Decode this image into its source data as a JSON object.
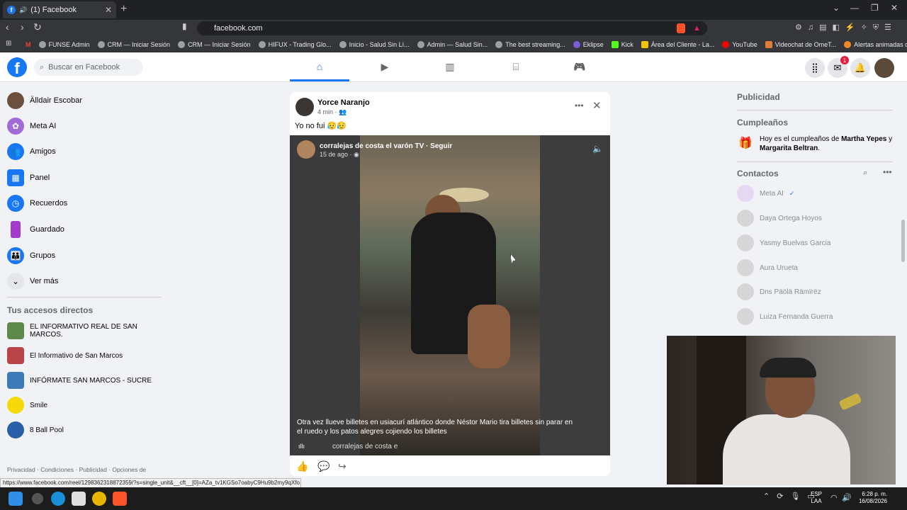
{
  "browser": {
    "tab_title": "(1) Facebook",
    "url": "facebook.com",
    "bookmarks": [
      "FUNSE Admin",
      "CRM — Iniciar Sesión",
      "CRM — Iniciar Sesión",
      "HIFUX - Trading Glo...",
      "Inicio - Salud Sin Lí...",
      "Admin — Salud Sin...",
      "The best streaming...",
      "Eklipse",
      "Kick",
      "Área del Cliente - La...",
      "YouTube",
      "Videochat de OmeT...",
      "Alertas animadas de..."
    ],
    "status_link": "https://www.facebook.com/reel/1298362318872359/?s=single_unit&__cft__[0]=AZa_tv1KGSo7oabyC9Hu9b2my9qXfo..."
  },
  "header": {
    "search_placeholder": "Buscar en Facebook",
    "messenger_badge": "1"
  },
  "sidebar": {
    "items": [
      {
        "label": "Älldair Escobar",
        "icon": "avatar",
        "color": "#6b5040"
      },
      {
        "label": "Meta AI",
        "icon": "meta-ai-icon",
        "color": "#a06cd5"
      },
      {
        "label": "Amigos",
        "icon": "friends-icon",
        "color": "#1877f2"
      },
      {
        "label": "Panel",
        "icon": "dashboard-icon",
        "color": "#1877f2"
      },
      {
        "label": "Recuerdos",
        "icon": "clock-icon",
        "color": "#1877f2"
      },
      {
        "label": "Guardado",
        "icon": "bookmark-icon",
        "color": "#a33ac9"
      },
      {
        "label": "Grupos",
        "icon": "groups-icon",
        "color": "#1877f2"
      },
      {
        "label": "Ver más",
        "icon": "chevron-down-icon",
        "color": "#e4e6eb"
      }
    ],
    "shortcuts_heading": "Tus accesos directos",
    "shortcuts": [
      {
        "label": "EL INFORMATIVO REAL DE SAN MARCOS.",
        "color": "#5d8a4a"
      },
      {
        "label": "El Informativo de San Marcos",
        "color": "#b8444a"
      },
      {
        "label": "INFÓRMATE SAN MARCOS - SUCRE",
        "color": "#3d7ab8"
      },
      {
        "label": "Smile",
        "color": "#f5d90a"
      },
      {
        "label": "8 Ball Pool",
        "color": "#2a5ea8"
      }
    ],
    "footer": "Privacidad · Condiciones · Publicidad · Opciones de"
  },
  "post": {
    "author": "Yorce Naranjo",
    "time": "4 min · ",
    "text": "Yo no fui 😥😥",
    "video": {
      "page": "corralejas de costa el varón TV · Seguir",
      "time": "15 de ago · ",
      "caption": "Otra vez llueve billetes en usiacurí atlántico donde Néstor Mario tira billetes sin parar en el ruedo y los patos alegres cojiendo los billetes",
      "bottom_label": "corralejas de costa e"
    }
  },
  "right": {
    "ads_heading": "Publicidad",
    "birthdays_heading": "Cumpleaños",
    "birthday_prefix": "Hoy es el cumpleaños de ",
    "birthday_name1": "Martha Yepes",
    "birthday_mid": " y ",
    "birthday_name2": "Margarita Beltran",
    "birthday_suffix": ".",
    "contacts_heading": "Contactos",
    "contacts": [
      "Meta AI",
      "Daya Ortega Hoyos",
      "Yasmy Buelvas Garcia",
      "Aura Urueta",
      "Dns Päölä Rämïrëz",
      "Luiza Fernanda Guerra"
    ]
  },
  "taskbar": {
    "lang_line1": "ESP",
    "lang_line2": "LAA",
    "time": "6:28 p. m.",
    "date": "16/08/2026"
  }
}
